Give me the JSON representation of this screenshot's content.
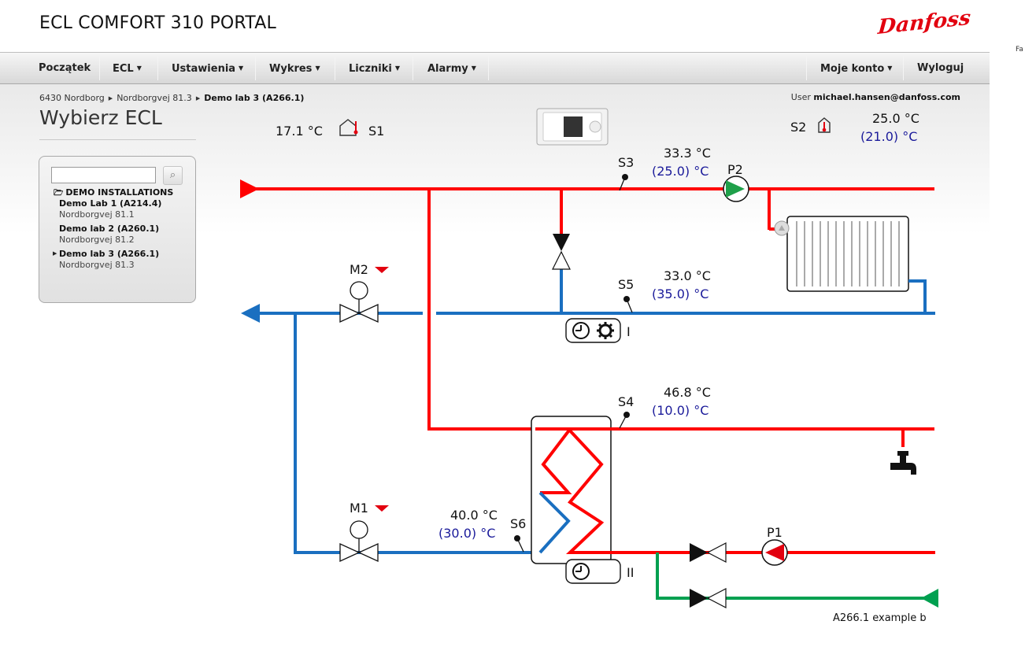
{
  "app": {
    "title": "ECL COMFORT 310 PORTAL",
    "brand": "Danfoss"
  },
  "nav": {
    "items": [
      {
        "label": "Początek",
        "caret": ""
      },
      {
        "label": "ECL",
        "caret": "▼"
      },
      {
        "label": "Ustawienia",
        "caret": "▼"
      },
      {
        "label": "Wykres",
        "caret": "▼"
      },
      {
        "label": "Liczniki",
        "caret": "▼"
      },
      {
        "label": "Alarmy",
        "caret": "▼"
      }
    ],
    "right": [
      {
        "label": "Moje konto",
        "caret": "▼"
      },
      {
        "label": "Wyloguj",
        "caret": ""
      }
    ]
  },
  "breadcrumb": [
    "6430 Nordborg",
    "Nordborgvej 81.3",
    "Demo lab 3 (A266.1)"
  ],
  "user": {
    "prefix": "User",
    "email": "michael.hansen@danfoss.com"
  },
  "page_title": "Wybierz ECL",
  "sidebar": {
    "search": {
      "value": "",
      "placeholder": ""
    },
    "root_label": "DEMO INSTALLATIONS",
    "items": [
      {
        "name": "Demo Lab 1 (A214.4)",
        "address": "Nordborgvej 81.1",
        "selected": false
      },
      {
        "name": "Demo lab 2 (A260.1)",
        "address": "Nordborgvej 81.2",
        "selected": false
      },
      {
        "name": "Demo lab 3 (A266.1)",
        "address": "Nordborgvej 81.3",
        "selected": true
      }
    ]
  },
  "diagram": {
    "sensors": {
      "S1": {
        "label": "S1",
        "value": "17.1 °C"
      },
      "S2": {
        "label": "S2",
        "value": "25.0 °C",
        "setpoint": "(21.0) °C"
      },
      "S3": {
        "label": "S3",
        "value": "33.3 °C",
        "setpoint": "(25.0) °C"
      },
      "S4": {
        "label": "S4",
        "value": "46.8 °C",
        "setpoint": "(10.0) °C"
      },
      "S5": {
        "label": "S5",
        "value": "33.0 °C",
        "setpoint": "(35.0) °C"
      },
      "S6": {
        "label": "S6",
        "value": "40.0 °C",
        "setpoint": "(30.0) °C"
      }
    },
    "pumps": {
      "P1": "P1",
      "P2": "P2"
    },
    "valves": {
      "M1": "M1",
      "M2": "M2"
    },
    "circuits": {
      "c1": "I",
      "c2": "II"
    },
    "caption": "A266.1 example b",
    "colors": {
      "supply": "#ff0000",
      "return": "#1a6fc0",
      "dhw_circ": "#00a050",
      "pump_on": "#1fa04a",
      "pump_alarm": "#e2000f"
    }
  },
  "side_strip": {
    "label": "Fa"
  }
}
